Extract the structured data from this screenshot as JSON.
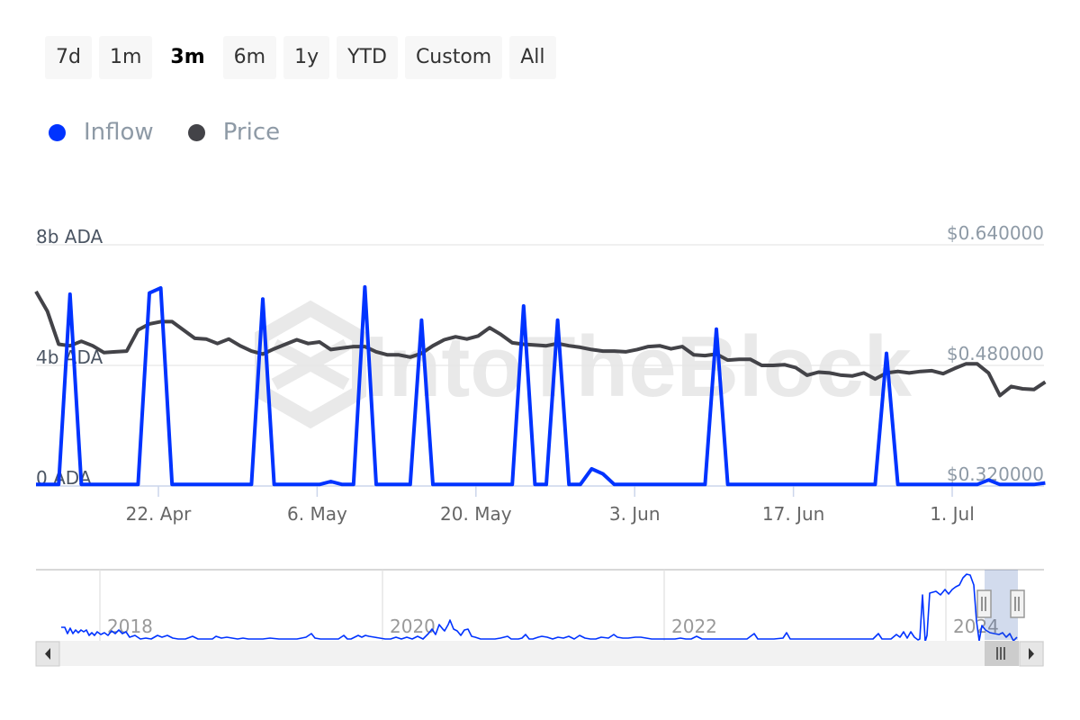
{
  "range_selector": {
    "buttons": [
      "7d",
      "1m",
      "3m",
      "6m",
      "1y",
      "YTD",
      "Custom",
      "All"
    ],
    "active": "3m"
  },
  "legend": [
    {
      "name": "Inflow",
      "color": "#0033ff"
    },
    {
      "name": "Price",
      "color": "#434348"
    }
  ],
  "watermark": "IntoTheBlock",
  "chart_data": {
    "type": "line",
    "title": "",
    "x_start": "2024-04-11",
    "x_unit": "day",
    "x_tick_labels": [
      "22. Apr",
      "6. May",
      "20. May",
      "3. Jun",
      "17. Jun",
      "1. Jul"
    ],
    "x_tick_day_index": [
      11,
      25,
      39,
      53,
      67,
      81
    ],
    "y_left": {
      "label_ticks": [
        "0 ADA",
        "4b ADA",
        "8b ADA"
      ],
      "tick_values": [
        0,
        4,
        8
      ],
      "range": [
        0,
        8
      ],
      "unit": "billion ADA"
    },
    "y_right": {
      "label_ticks": [
        "$0.320000",
        "$0.480000",
        "$0.640000"
      ],
      "tick_values": [
        0.32,
        0.48,
        0.64
      ],
      "range": [
        0.32,
        0.64
      ],
      "unit": "USD"
    },
    "grid": true,
    "legend_position": "top-left",
    "series": [
      {
        "name": "Inflow",
        "axis": "left",
        "color": "#0033ff",
        "values": [
          0.05,
          0.05,
          0.05,
          6.36,
          0.05,
          0.05,
          0.05,
          0.05,
          0.05,
          0.05,
          6.4,
          6.57,
          0.05,
          0.05,
          0.05,
          0.05,
          0.05,
          0.05,
          0.05,
          0.05,
          6.2,
          0.05,
          0.05,
          0.05,
          0.05,
          0.05,
          0.15,
          0.05,
          0.05,
          6.6,
          0.05,
          0.05,
          0.05,
          0.05,
          5.5,
          0.05,
          0.05,
          0.05,
          0.05,
          0.05,
          0.05,
          0.05,
          0.05,
          5.97,
          0.05,
          0.05,
          5.5,
          0.05,
          0.05,
          0.57,
          0.4,
          0.05,
          0.05,
          0.05,
          0.05,
          0.05,
          0.05,
          0.05,
          0.05,
          0.05,
          5.2,
          0.05,
          0.05,
          0.05,
          0.05,
          0.05,
          0.05,
          0.05,
          0.05,
          0.05,
          0.05,
          0.05,
          0.05,
          0.05,
          0.05,
          4.4,
          0.05,
          0.05,
          0.05,
          0.05,
          0.05,
          0.05,
          0.05,
          0.05,
          0.2,
          0.05,
          0.05,
          0.05,
          0.05,
          0.1
        ]
      },
      {
        "name": "Price",
        "axis": "right",
        "color": "#434348",
        "values": [
          0.578,
          0.552,
          0.508,
          0.506,
          0.512,
          0.506,
          0.497,
          0.498,
          0.499,
          0.527,
          0.535,
          0.538,
          0.538,
          0.527,
          0.516,
          0.515,
          0.509,
          0.515,
          0.506,
          0.499,
          0.495,
          0.502,
          0.508,
          0.514,
          0.509,
          0.511,
          0.501,
          0.503,
          0.505,
          0.505,
          0.498,
          0.494,
          0.494,
          0.491,
          0.496,
          0.506,
          0.514,
          0.518,
          0.515,
          0.519,
          0.53,
          0.521,
          0.51,
          0.508,
          0.507,
          0.506,
          0.509,
          0.506,
          0.504,
          0.501,
          0.499,
          0.499,
          0.498,
          0.501,
          0.505,
          0.506,
          0.502,
          0.505,
          0.494,
          0.493,
          0.495,
          0.487,
          0.488,
          0.488,
          0.48,
          0.48,
          0.481,
          0.477,
          0.467,
          0.471,
          0.47,
          0.467,
          0.466,
          0.47,
          0.462,
          0.47,
          0.472,
          0.47,
          0.472,
          0.473,
          0.469,
          0.476,
          0.482,
          0.482,
          0.47,
          0.44,
          0.452,
          0.449,
          0.448,
          0.458
        ]
      }
    ],
    "navigator": {
      "year_labels": [
        "2018",
        "2020",
        "2022",
        "2024"
      ],
      "series": "Inflow",
      "selected_range": "3m"
    }
  }
}
